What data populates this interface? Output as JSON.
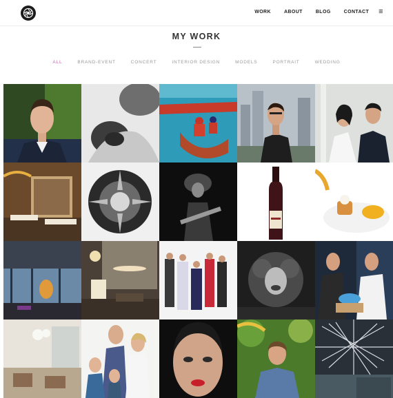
{
  "header": {
    "logo_icon": "aperture-icon",
    "nav": [
      {
        "label": "WORK"
      },
      {
        "label": "ABOUT"
      },
      {
        "label": "BLOG"
      },
      {
        "label": "CONTACT"
      }
    ],
    "menu_icon": "hamburger-menu-icon"
  },
  "page": {
    "title": "MY WORK"
  },
  "filters": [
    {
      "label": "ALL",
      "active": true
    },
    {
      "label": "BRAND-EVENT",
      "active": false
    },
    {
      "label": "CONCERT",
      "active": false
    },
    {
      "label": "INTERIOR DESIGN",
      "active": false
    },
    {
      "label": "MODELS",
      "active": false
    },
    {
      "label": "PORTRAIT",
      "active": false
    },
    {
      "label": "WEDDING",
      "active": false
    }
  ],
  "colors": {
    "accent": "#c06ab0",
    "filter_inactive": "#9a9a9a",
    "text": "#222222"
  }
}
